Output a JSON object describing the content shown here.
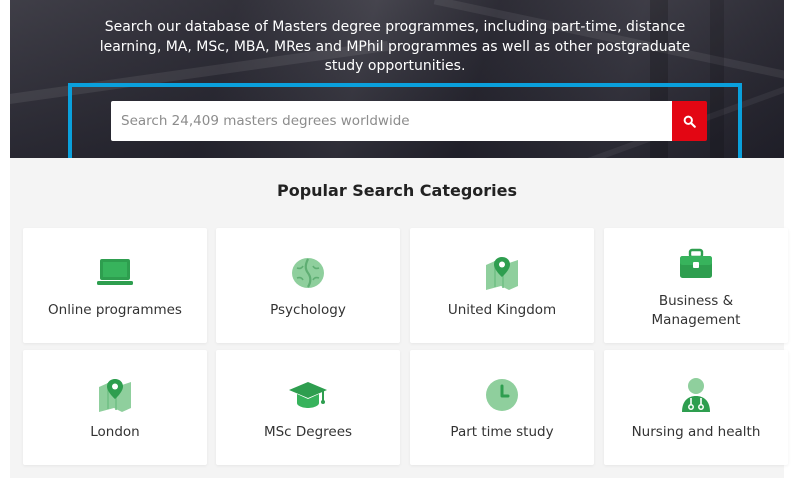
{
  "hero": {
    "description": "Search our database of Masters degree programmes, including part-time, distance learning, MA, MSc, MBA, MRes and MPhil programmes as well as other postgraduate study opportunities."
  },
  "search": {
    "placeholder": "Search 24,409 masters degrees worldwide",
    "button_icon": "search-icon",
    "button_color": "#e30613"
  },
  "highlight_color": "#0aa0dc",
  "categories": {
    "title": "Popular Search Categories",
    "accent_color": "#2e9e4f",
    "items": [
      {
        "label": "Online programmes",
        "icon": "laptop-icon"
      },
      {
        "label": "Psychology",
        "icon": "brain-icon"
      },
      {
        "label": "United Kingdom",
        "icon": "map-pin-icon"
      },
      {
        "label": "Business & Management",
        "icon": "briefcase-icon"
      },
      {
        "label": "London",
        "icon": "map-pin-icon"
      },
      {
        "label": "MSc Degrees",
        "icon": "graduation-cap-icon"
      },
      {
        "label": "Part time study",
        "icon": "clock-icon"
      },
      {
        "label": "Nursing and health",
        "icon": "nurse-icon"
      }
    ]
  }
}
